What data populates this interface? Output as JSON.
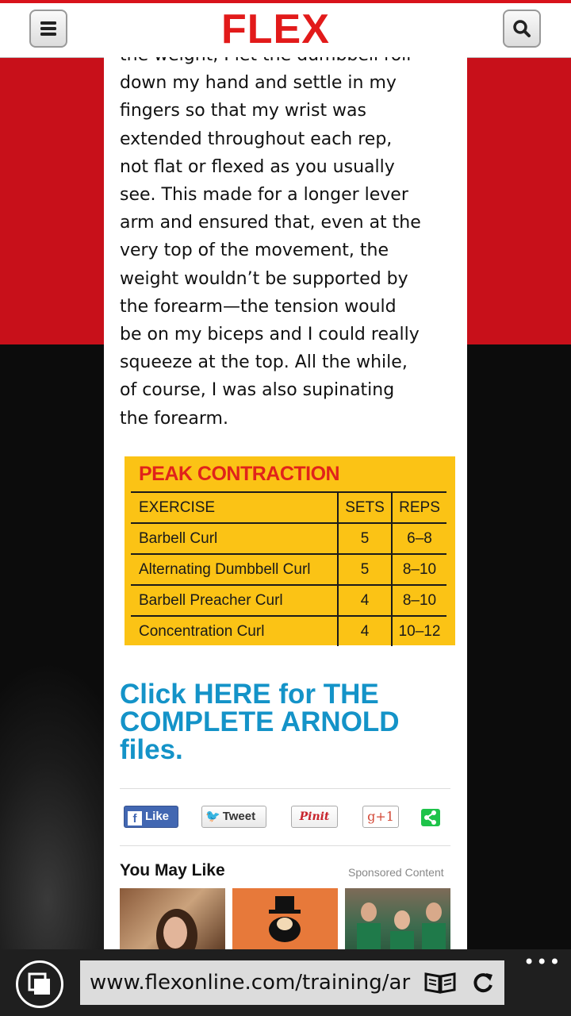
{
  "header": {
    "logo_text": "FLEX",
    "menu_icon": "hamburger-menu-icon",
    "search_icon": "search-icon"
  },
  "article": {
    "lines": [
      "the weight, I let the dumbbell roll",
      "down my hand and settle in my",
      "fingers so that my wrist was",
      "extended throughout each rep,",
      "not flat or flexed as you usually",
      "see. This made for a longer lever",
      "arm and ensured that, even at the",
      "very top of the movement, the",
      "weight wouldn’t be supported by",
      "the forearm—the tension would",
      "be on my biceps and I could really",
      "squeeze at the top. All the while,",
      "of course, I was also supinating",
      "the forearm."
    ]
  },
  "table": {
    "title": "PEAK CONTRACTION",
    "headers": [
      "EXERCISE",
      "SETS",
      "REPS"
    ],
    "rows": [
      [
        "Barbell Curl",
        "5",
        "6–8"
      ],
      [
        "Alternating Dumbbell Curl",
        "5",
        "8–10"
      ],
      [
        "Barbell Preacher Curl",
        "4",
        "8–10"
      ],
      [
        "Concentration Curl",
        "4",
        "10–12"
      ]
    ]
  },
  "cta": {
    "text": "Click HERE for THE COMPLETE ARNOLD files."
  },
  "share": {
    "like": "Like",
    "tweet": "Tweet",
    "pin": "Pinit",
    "gplus": "g+1",
    "share_icon": "share-icon"
  },
  "recommend": {
    "title": "You May Like",
    "sponsored": "Sponsored Content"
  },
  "browser": {
    "url": "www.flexonline.com/training/ar",
    "more": "•••",
    "tabs_icon": "tabs-icon",
    "reader_icon": "reading-view-icon",
    "refresh_icon": "refresh-icon"
  },
  "colors": {
    "brand_red": "#e21a1a",
    "link_blue": "#1493c8",
    "table_yellow": "#fbc315"
  }
}
